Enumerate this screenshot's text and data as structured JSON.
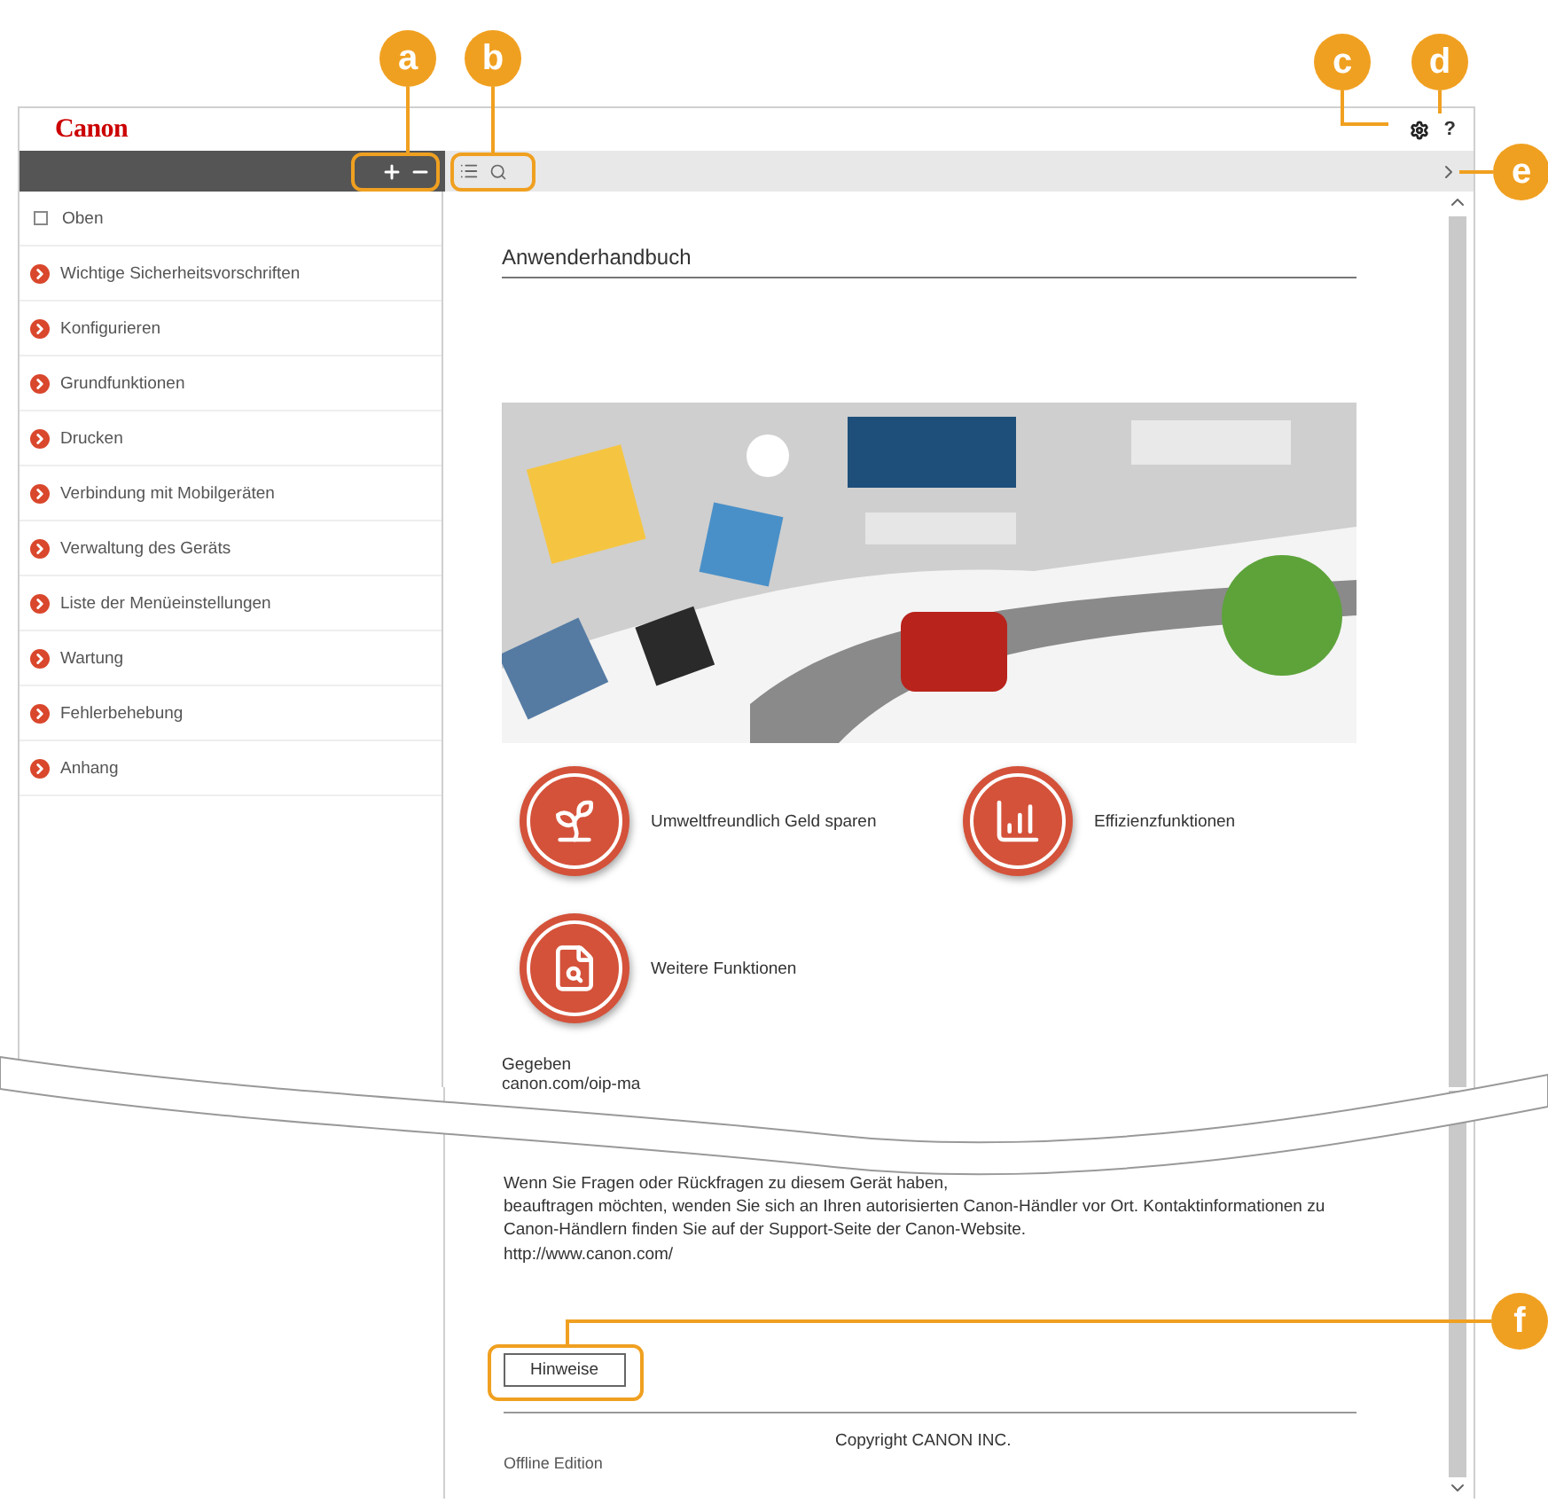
{
  "header": {
    "logo": "Canon",
    "help": "?"
  },
  "sidebar": {
    "items": [
      {
        "kind": "page",
        "label": "Oben"
      },
      {
        "kind": "chapter",
        "label": "Wichtige Sicherheitsvorschriften"
      },
      {
        "kind": "chapter",
        "label": "Konfigurieren"
      },
      {
        "kind": "chapter",
        "label": "Grundfunktionen"
      },
      {
        "kind": "chapter",
        "label": "Drucken"
      },
      {
        "kind": "chapter",
        "label": "Verbindung mit Mobilgeräten"
      },
      {
        "kind": "chapter",
        "label": "Verwaltung des Geräts"
      },
      {
        "kind": "chapter",
        "label": "Liste der Menüeinstellungen"
      },
      {
        "kind": "chapter",
        "label": "Wartung"
      },
      {
        "kind": "chapter",
        "label": "Fehlerbehebung"
      },
      {
        "kind": "chapter",
        "label": "Anhang"
      }
    ]
  },
  "content": {
    "title": "Anwenderhandbuch",
    "banner": {
      "kind": "picture"
    },
    "features": [
      {
        "kind": "eco",
        "label": "Umweltfreundlich Geld sparen"
      },
      {
        "kind": "efficiency",
        "label": "Effizienzfunktionen"
      },
      {
        "kind": "more",
        "label": "Weitere Funktionen"
      }
    ],
    "cut_lines": [
      "Gegeben",
      "canon.com/oip-ma"
    ],
    "contact_first_line": "Wenn Sie Fragen oder Rückfragen zu diesem Gerät haben,",
    "contact_text": "beauftragen möchten, wenden Sie sich an Ihren autorisierten Canon-Händler vor Ort. Kontaktinformationen zu Canon-Händlern finden Sie auf der Support-Seite der Canon-Website.",
    "link": "http://www.canon.com/",
    "notes_button": "Hinweise",
    "copyright": "Copyright CANON INC.",
    "edition": "Offline Edition"
  },
  "callouts": [
    {
      "letter": "a"
    },
    {
      "letter": "b"
    },
    {
      "letter": "c"
    },
    {
      "letter": "d"
    },
    {
      "letter": "e"
    },
    {
      "letter": "f"
    }
  ]
}
